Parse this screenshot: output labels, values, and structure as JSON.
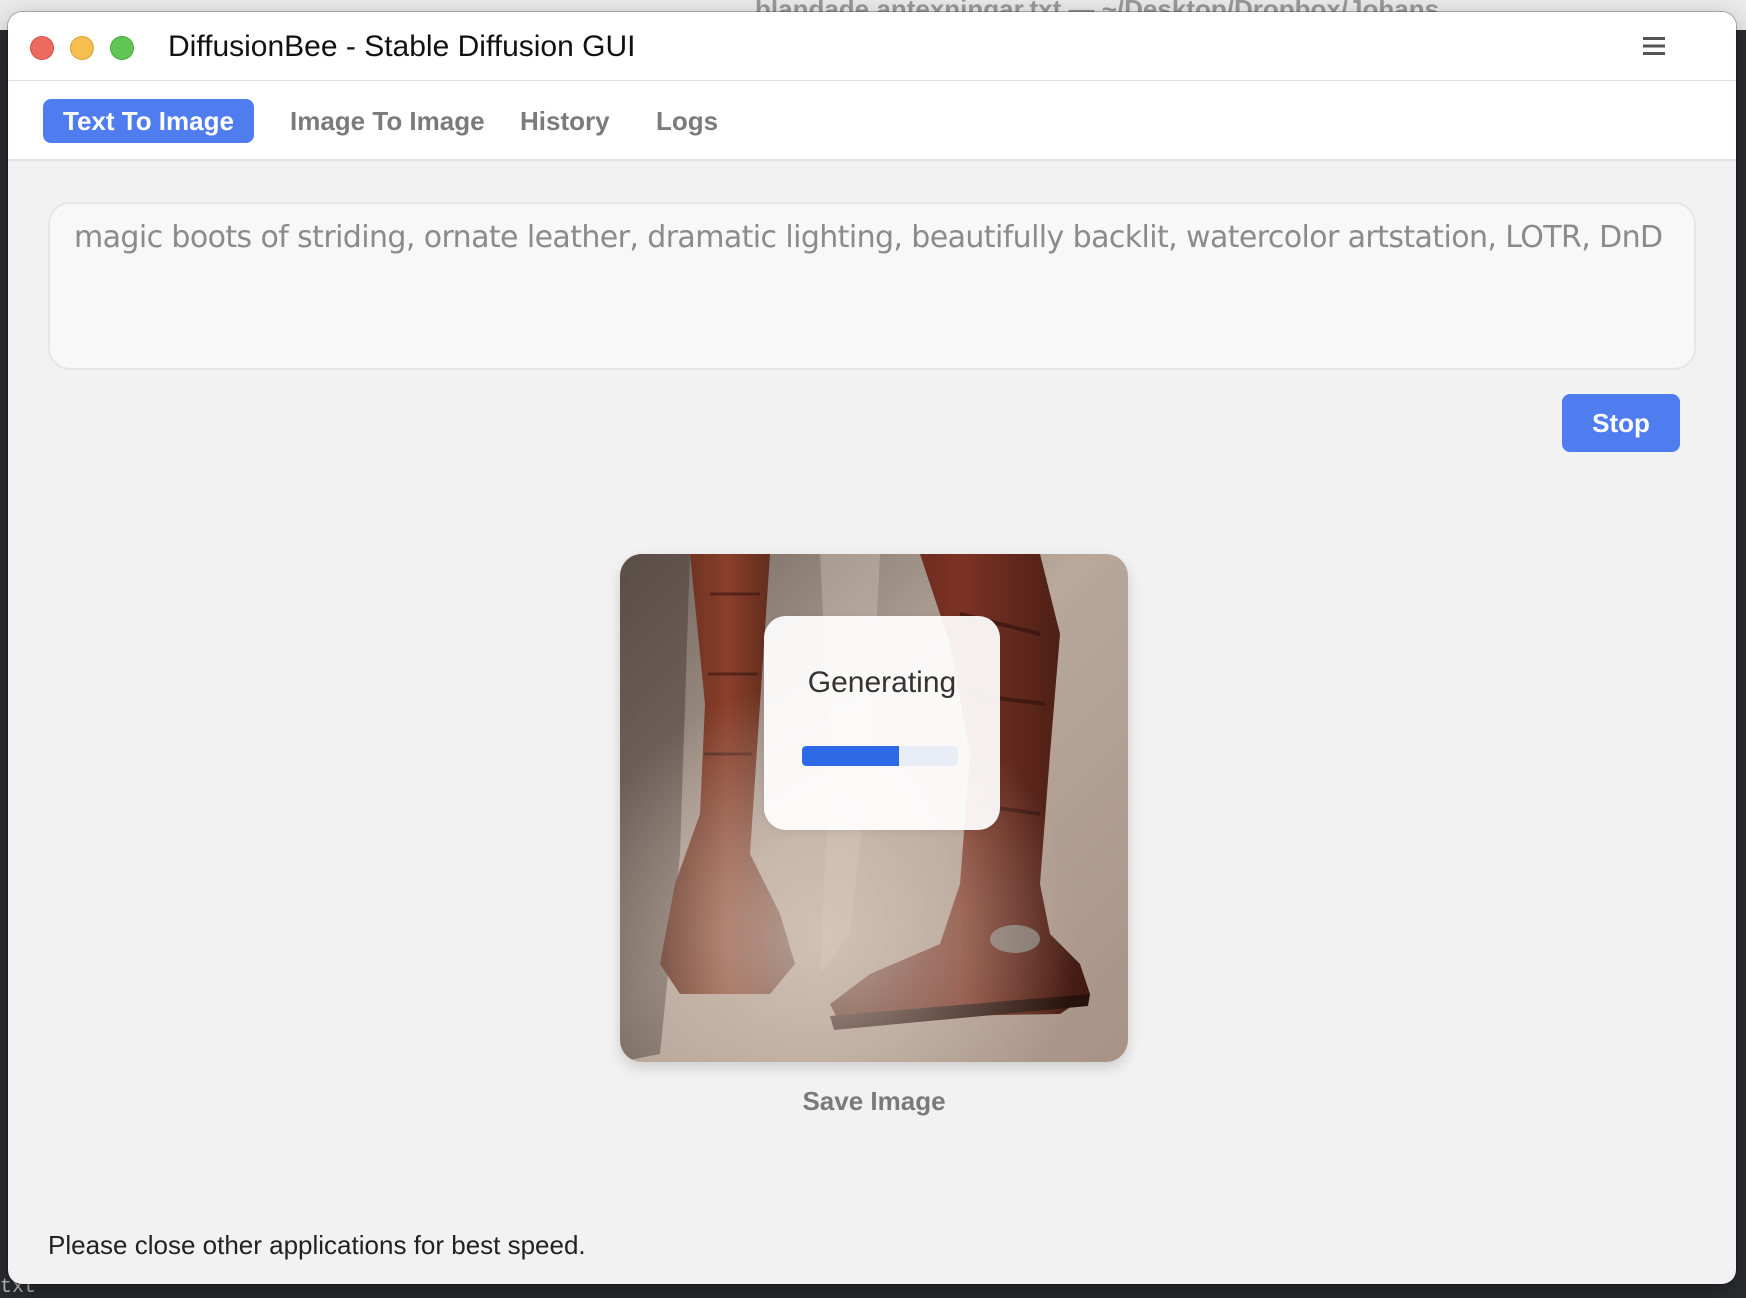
{
  "window": {
    "title": "DiffusionBee - Stable Diffusion GUI"
  },
  "background": {
    "ghost_title": "blandade antexningar.txt — ~/Desktop/Dropbox/Johans",
    "bottom_text": "txt"
  },
  "tabs": [
    {
      "label": "Text To Image",
      "active": true
    },
    {
      "label": "Image To Image",
      "active": false
    },
    {
      "label": "History",
      "active": false
    },
    {
      "label": "Logs",
      "active": false
    }
  ],
  "prompt": {
    "text": "magic boots of striding, ornate leather, dramatic lighting, beautifully backlit, watercolor artstation, LOTR, DnD"
  },
  "actions": {
    "stop_label": "Stop",
    "save_label": "Save Image"
  },
  "generation": {
    "status": "Generating",
    "progress": 0.62
  },
  "footer": {
    "note": "Please close other applications for best speed."
  },
  "icons": {
    "menu": "hamburger-menu-icon"
  },
  "colors": {
    "accent": "#4f7df0",
    "progress": "#2f6ae6"
  }
}
